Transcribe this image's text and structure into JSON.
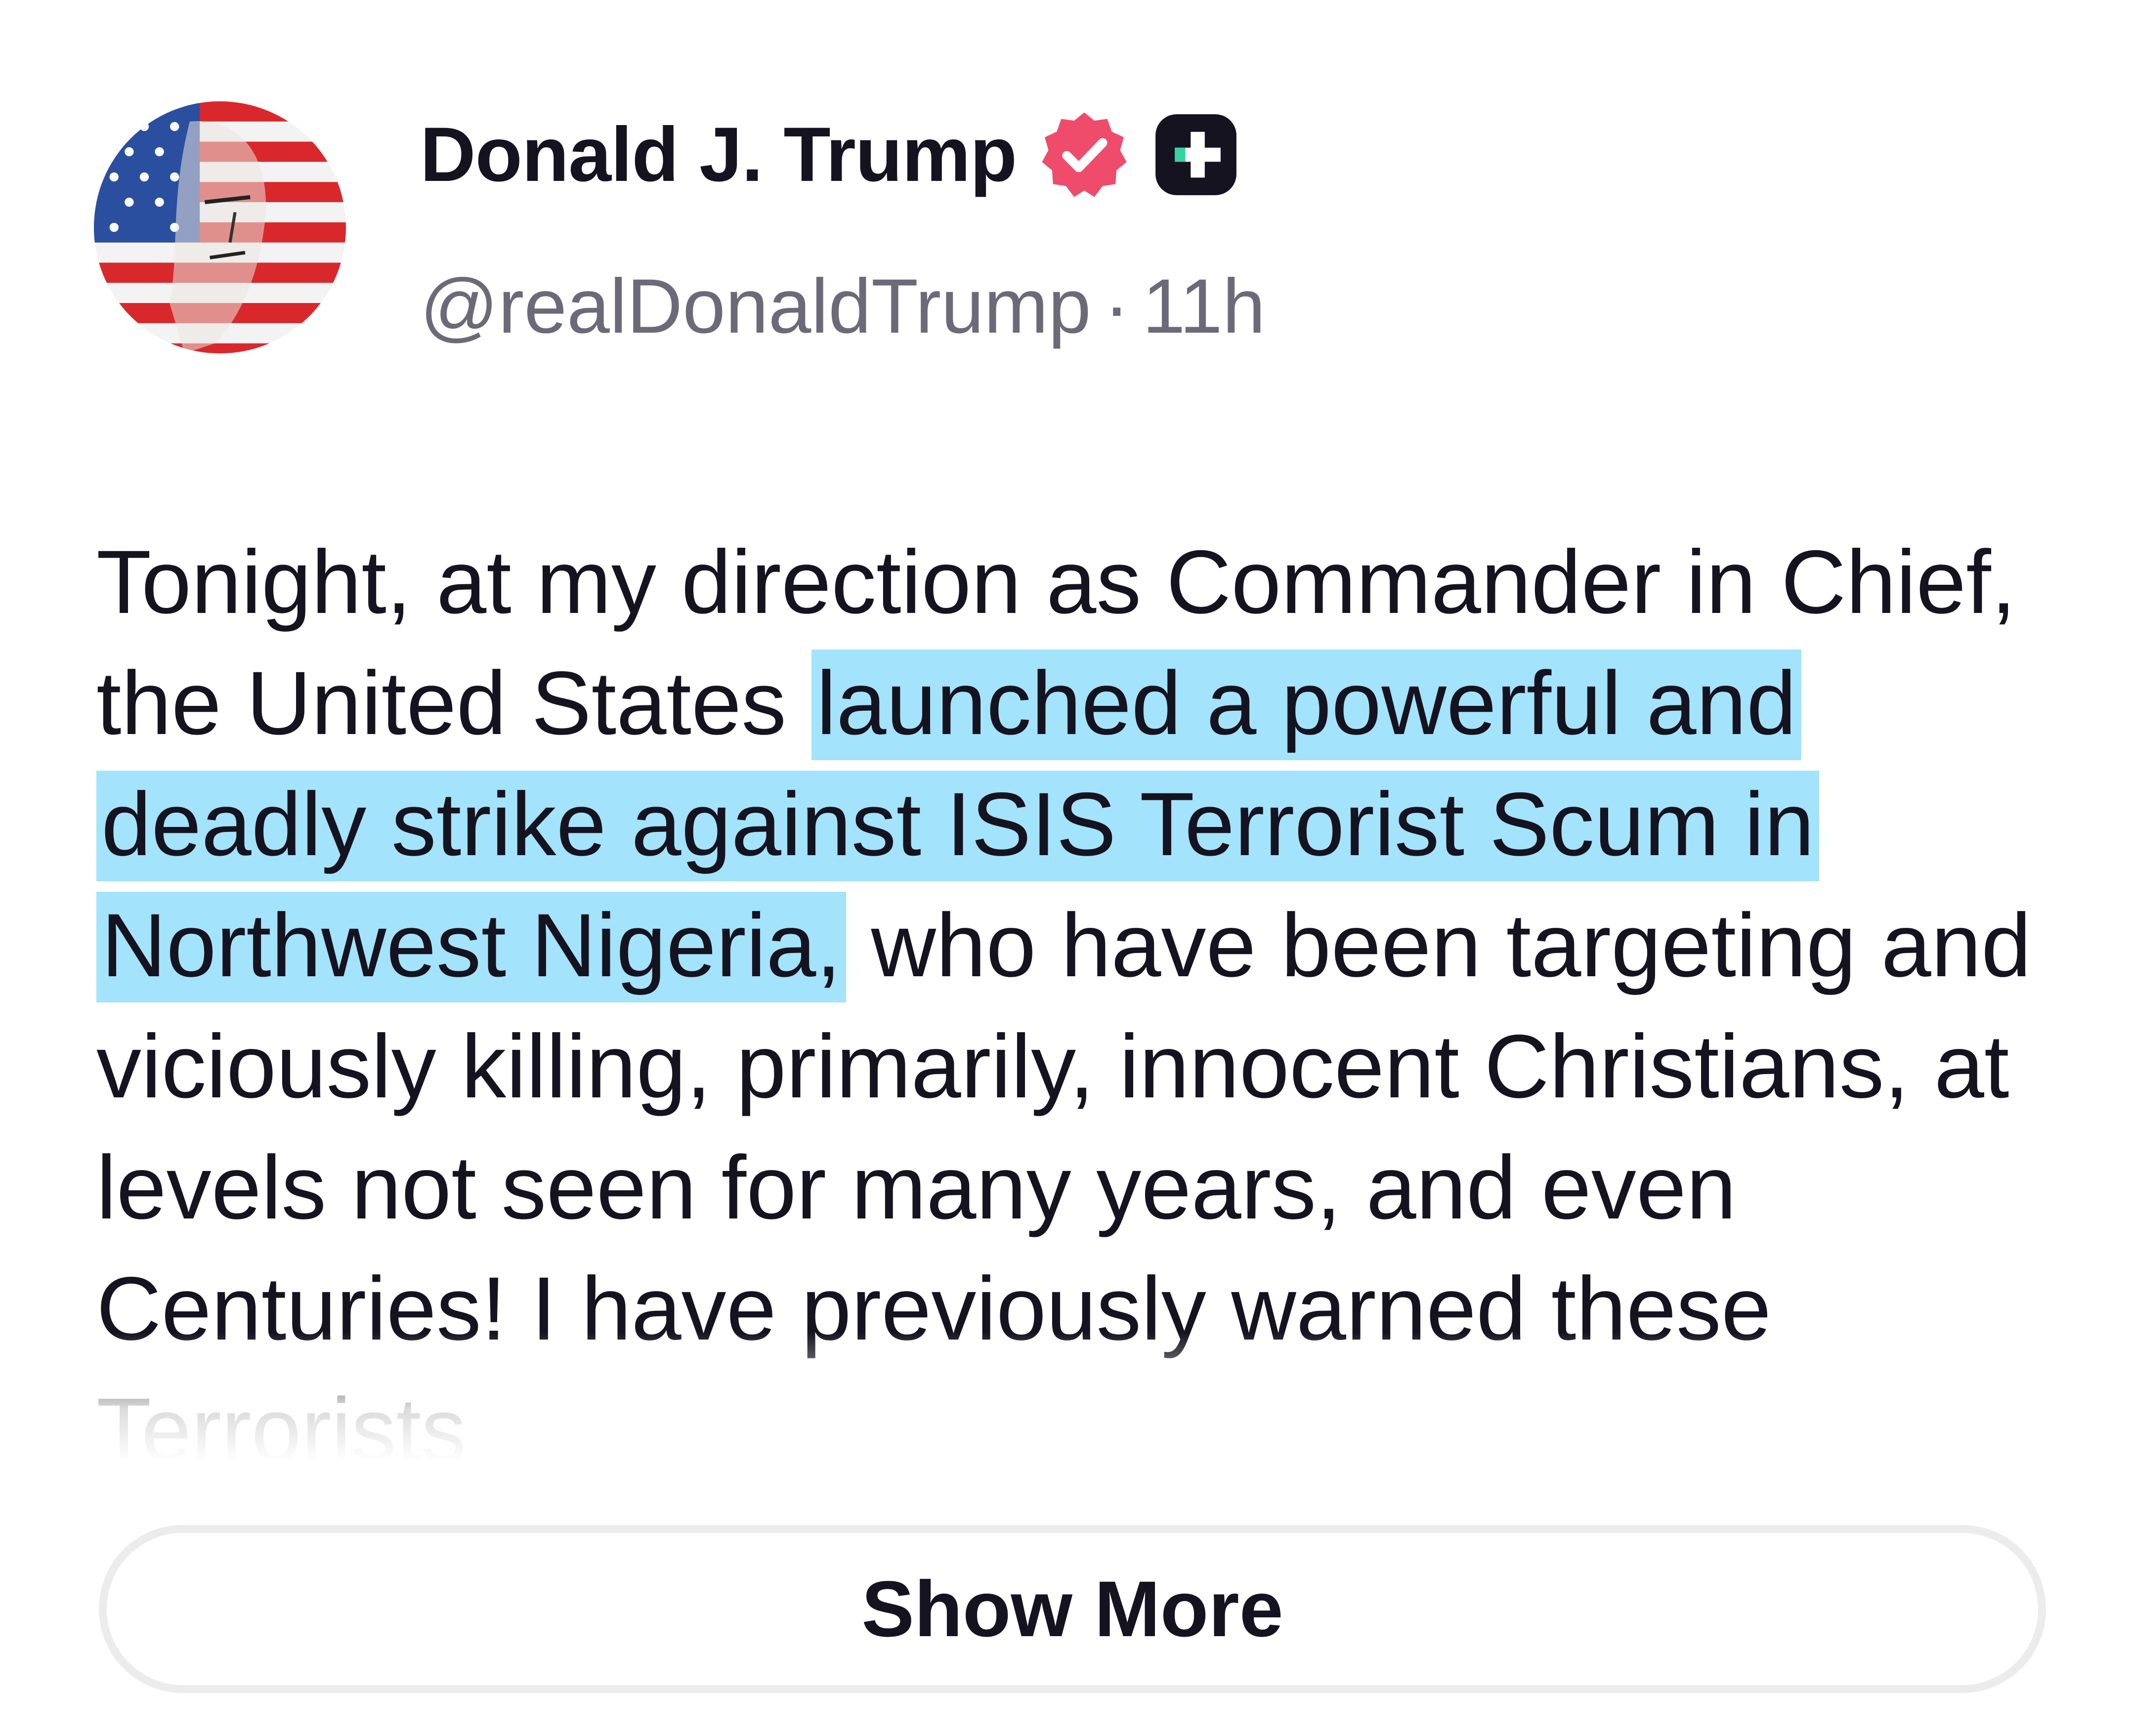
{
  "post": {
    "author": {
      "display_name": "Donald J. Trump",
      "handle": "@realDonaldTrump",
      "separator": "·",
      "time_ago": "11h",
      "verified_badge_color": "#ef4b6b",
      "plus_badge_color": "#14131f",
      "plus_badge_accent": "#34d3a0"
    },
    "text": {
      "before_highlight": "Tonight, at my direction as Commander in Chief, the United States ",
      "highlighted": "launched a powerful and deadly strike against ISIS Terrorist Scum in Northwest Nigeria,",
      "after_highlight": " who have been targeting and viciously killing, primarily, innocent Christians, at levels not seen for many years, and even Centuries! I have previously warned these Terrorists",
      "highlight_color": "#a3e3fb"
    },
    "show_more_label": "Show More"
  },
  "icons": {
    "avatar": "flag-painted-portrait-avatar",
    "verified": "verified-check-icon",
    "plus": "plus-badge-icon"
  }
}
